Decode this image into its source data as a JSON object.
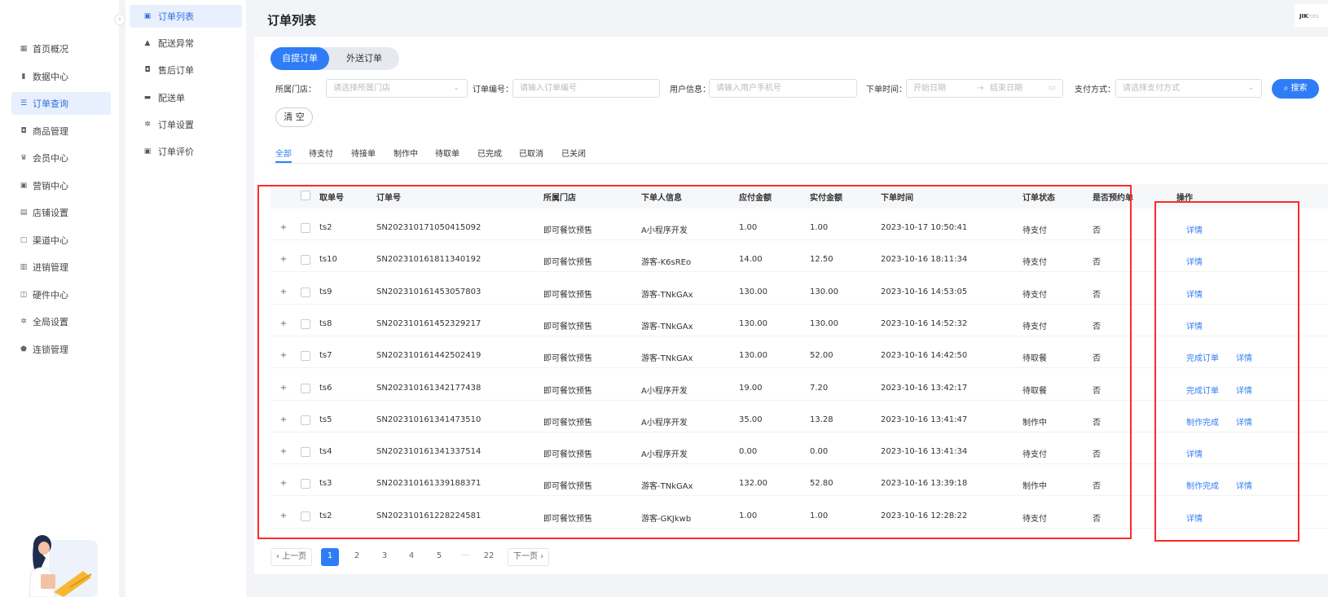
{
  "nav": {
    "collapse_glyph": "‹",
    "items": [
      {
        "label": "首页概况",
        "icon": "grid-icon"
      },
      {
        "label": "数据中心",
        "icon": "bar-chart-icon"
      },
      {
        "label": "订单查询",
        "icon": "list-icon"
      },
      {
        "label": "商品管理",
        "icon": "bag-icon"
      },
      {
        "label": "会员中心",
        "icon": "crown-icon"
      },
      {
        "label": "营销中心",
        "icon": "gift-icon"
      },
      {
        "label": "店铺设置",
        "icon": "store-icon"
      },
      {
        "label": "渠道中心",
        "icon": "channel-icon"
      },
      {
        "label": "进销管理",
        "icon": "inventory-icon"
      },
      {
        "label": "硬件中心",
        "icon": "device-icon"
      },
      {
        "label": "全局设置",
        "icon": "gear-icon"
      },
      {
        "label": "连锁管理",
        "icon": "shield-icon"
      }
    ]
  },
  "subnav": {
    "items": [
      {
        "label": "订单列表",
        "icon": "document-icon"
      },
      {
        "label": "配送异常",
        "icon": "warning-icon"
      },
      {
        "label": "售后订单",
        "icon": "bag-icon"
      },
      {
        "label": "配送单",
        "icon": "truck-icon"
      },
      {
        "label": "订单设置",
        "icon": "gear-icon"
      },
      {
        "label": "订单评价",
        "icon": "comment-icon"
      }
    ]
  },
  "header": {
    "title": "订单列表",
    "user_brand_a": "JIK",
    "user_brand_b": "mts"
  },
  "segments": {
    "active": "自提订单",
    "other": "外送订单"
  },
  "filters": {
    "store_label": "所属门店：",
    "store_placeholder": "请选择所属门店",
    "order_label": "订单编号：",
    "order_placeholder": "请输入订单编号",
    "user_label": "用户信息：",
    "user_placeholder": "请输入用户手机号",
    "time_label": "下单时间：",
    "start_placeholder": "开始日期",
    "range_sep": "→",
    "end_placeholder": "结束日期",
    "pay_label": "支付方式：",
    "pay_placeholder": "请选择支付方式",
    "search_label": "搜索",
    "clear_label": "清 空"
  },
  "tabs": [
    "全部",
    "待支付",
    "待接单",
    "制作中",
    "待取单",
    "已完成",
    "已取消",
    "已关闭"
  ],
  "table": {
    "headers": [
      "取单号",
      "订单号",
      "所属门店",
      "下单人信息",
      "应付金额",
      "实付金额",
      "下单时间",
      "订单状态",
      "是否预约单",
      "操作"
    ],
    "rows": [
      {
        "pick": "ts2",
        "order": "SN202310171050415092",
        "store": "即可餐饮预售",
        "user": "A小程序开发",
        "due": "1.00",
        "paid": "1.00",
        "time": "2023-10-17 10:50:41",
        "status": "待支付",
        "reserve": "否",
        "ops": [
          "详情"
        ]
      },
      {
        "pick": "ts10",
        "order": "SN202310161811340192",
        "store": "即可餐饮预售",
        "user": "游客-K6sREo",
        "due": "14.00",
        "paid": "12.50",
        "time": "2023-10-16 18:11:34",
        "status": "待支付",
        "reserve": "否",
        "ops": [
          "详情"
        ]
      },
      {
        "pick": "ts9",
        "order": "SN202310161453057803",
        "store": "即可餐饮预售",
        "user": "游客-TNkGAx",
        "due": "130.00",
        "paid": "130.00",
        "time": "2023-10-16 14:53:05",
        "status": "待支付",
        "reserve": "否",
        "ops": [
          "详情"
        ]
      },
      {
        "pick": "ts8",
        "order": "SN202310161452329217",
        "store": "即可餐饮预售",
        "user": "游客-TNkGAx",
        "due": "130.00",
        "paid": "130.00",
        "time": "2023-10-16 14:52:32",
        "status": "待支付",
        "reserve": "否",
        "ops": [
          "详情"
        ]
      },
      {
        "pick": "ts7",
        "order": "SN202310161442502419",
        "store": "即可餐饮预售",
        "user": "游客-TNkGAx",
        "due": "130.00",
        "paid": "52.00",
        "time": "2023-10-16 14:42:50",
        "status": "待取餐",
        "reserve": "否",
        "ops": [
          "完成订单",
          "详情"
        ]
      },
      {
        "pick": "ts6",
        "order": "SN202310161342177438",
        "store": "即可餐饮预售",
        "user": "A小程序开发",
        "due": "19.00",
        "paid": "7.20",
        "time": "2023-10-16 13:42:17",
        "status": "待取餐",
        "reserve": "否",
        "ops": [
          "完成订单",
          "详情"
        ]
      },
      {
        "pick": "ts5",
        "order": "SN202310161341473510",
        "store": "即可餐饮预售",
        "user": "A小程序开发",
        "due": "35.00",
        "paid": "13.28",
        "time": "2023-10-16 13:41:47",
        "status": "制作中",
        "reserve": "否",
        "ops": [
          "制作完成",
          "详情"
        ]
      },
      {
        "pick": "ts4",
        "order": "SN202310161341337514",
        "store": "即可餐饮预售",
        "user": "A小程序开发",
        "due": "0.00",
        "paid": "0.00",
        "time": "2023-10-16 13:41:34",
        "status": "待支付",
        "reserve": "否",
        "ops": [
          "详情"
        ]
      },
      {
        "pick": "ts3",
        "order": "SN202310161339188371",
        "store": "即可餐饮预售",
        "user": "游客-TNkGAx",
        "due": "132.00",
        "paid": "52.80",
        "time": "2023-10-16 13:39:18",
        "status": "制作中",
        "reserve": "否",
        "ops": [
          "制作完成",
          "详情"
        ]
      },
      {
        "pick": "ts2",
        "order": "SN202310161228224581",
        "store": "即可餐饮预售",
        "user": "游客-GKJkwb",
        "due": "1.00",
        "paid": "1.00",
        "time": "2023-10-16 12:28:22",
        "status": "待支付",
        "reserve": "否",
        "ops": [
          "详情"
        ]
      }
    ]
  },
  "pagination": {
    "prev": "‹ 上一页",
    "pages": [
      "1",
      "2",
      "3",
      "4",
      "5"
    ],
    "ellipsis": "···",
    "last": "22",
    "next": "下一页 ›",
    "current": "1"
  },
  "colors": {
    "accent": "#2f7df6",
    "highlight": "#ff2a2a"
  }
}
